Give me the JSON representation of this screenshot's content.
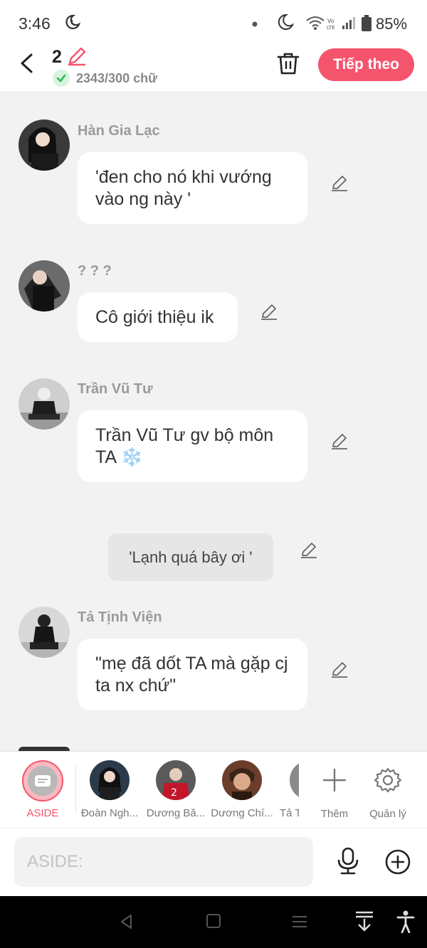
{
  "status": {
    "time": "3:46",
    "battery": "85%"
  },
  "header": {
    "count": "2",
    "words": "2343/300 chữ",
    "next_label": "Tiếp theo"
  },
  "messages": [
    {
      "name": "Hàn Gia Lạc",
      "text": "'đen cho nó khi vướng vào ng này '"
    },
    {
      "name": "? ? ?",
      "text": "Cô giới thiệu ik"
    },
    {
      "name": "Trần Vũ Tư",
      "text": "Trần Vũ Tư gv bộ môn TA ❄️"
    },
    {
      "name": "Tả Tịnh Viện",
      "text": "\"mẹ đã dốt TA mà gặp cj ta nx chứ\""
    }
  ],
  "aside_message": "'Lạnh quá bây ơi '",
  "characters": [
    {
      "label": "ASIDE"
    },
    {
      "label": "Đoàn Ngh..."
    },
    {
      "label": "Dương Bă..."
    },
    {
      "label": "Dương Chí..."
    },
    {
      "label": "Tả T"
    },
    {
      "label": "Thêm"
    },
    {
      "label": "Quản lý"
    }
  ],
  "input": {
    "placeholder": "ASIDE:"
  },
  "colors": {
    "accent": "#f5546d",
    "background": "#f2f2f2"
  }
}
